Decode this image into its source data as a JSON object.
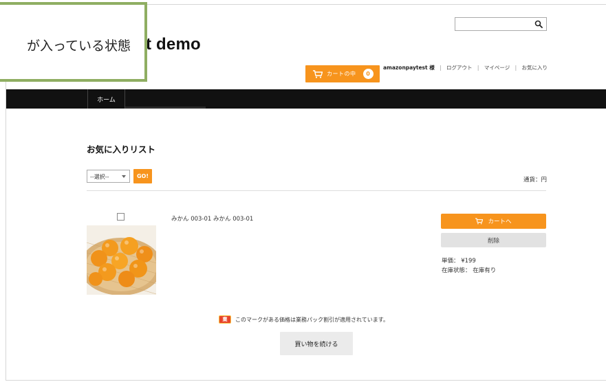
{
  "header": {
    "search": {
      "value": "",
      "placeholder": ""
    },
    "site_title": "t demo",
    "cart": {
      "label": "カートの中",
      "count": "0"
    },
    "user": {
      "name": "amazonpaytest 様",
      "links": [
        "ログアウト",
        "マイページ",
        "お気に入り"
      ]
    }
  },
  "annotation": {
    "text": "が入っている状態"
  },
  "nav": {
    "items": [
      {
        "label": "ホーム"
      }
    ]
  },
  "main": {
    "title": "お気に入りリスト",
    "select": {
      "value": "--選択--"
    },
    "go_label": "GO!",
    "currency": "通貨：円",
    "items": [
      {
        "name": "みかん 003-01 みかん 003-01",
        "add_to_cart_label": "カートへ",
        "delete_label": "削除",
        "price": "単価： ¥199",
        "stock": "在庫状態： 在庫有り"
      }
    ],
    "notice": {
      "badge": "業",
      "text": "このマークがある価格は業務パック割引が適用されています。"
    },
    "continue_label": "買い物を続ける"
  },
  "colors": {
    "accent": "#f7941d",
    "nav_bg": "#111111",
    "annotation_border": "#8fae62",
    "badge": "#e8442a"
  },
  "icons": {
    "search": "search-icon",
    "cart": "cart-icon",
    "badge": "discount-badge-icon"
  }
}
